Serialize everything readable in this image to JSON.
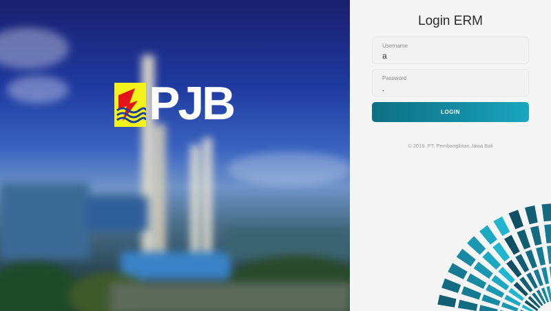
{
  "brand": {
    "logo_text": "PJB"
  },
  "login": {
    "title": "Login ERM",
    "username": {
      "label": "Username",
      "value": "a"
    },
    "password": {
      "label": "Password",
      "value": "."
    },
    "button_label": "LOGIN",
    "copyright": "© 2018. PT. Pembangkitan Jawa Bali"
  },
  "colors": {
    "accent": "#138ea6",
    "logo_yellow": "#f4f21b",
    "logo_red": "#e3151b",
    "fan_teal": "#1aa7bf"
  },
  "icons": [
    "pjb-logo-icon",
    "decorative-fan-graphic"
  ]
}
